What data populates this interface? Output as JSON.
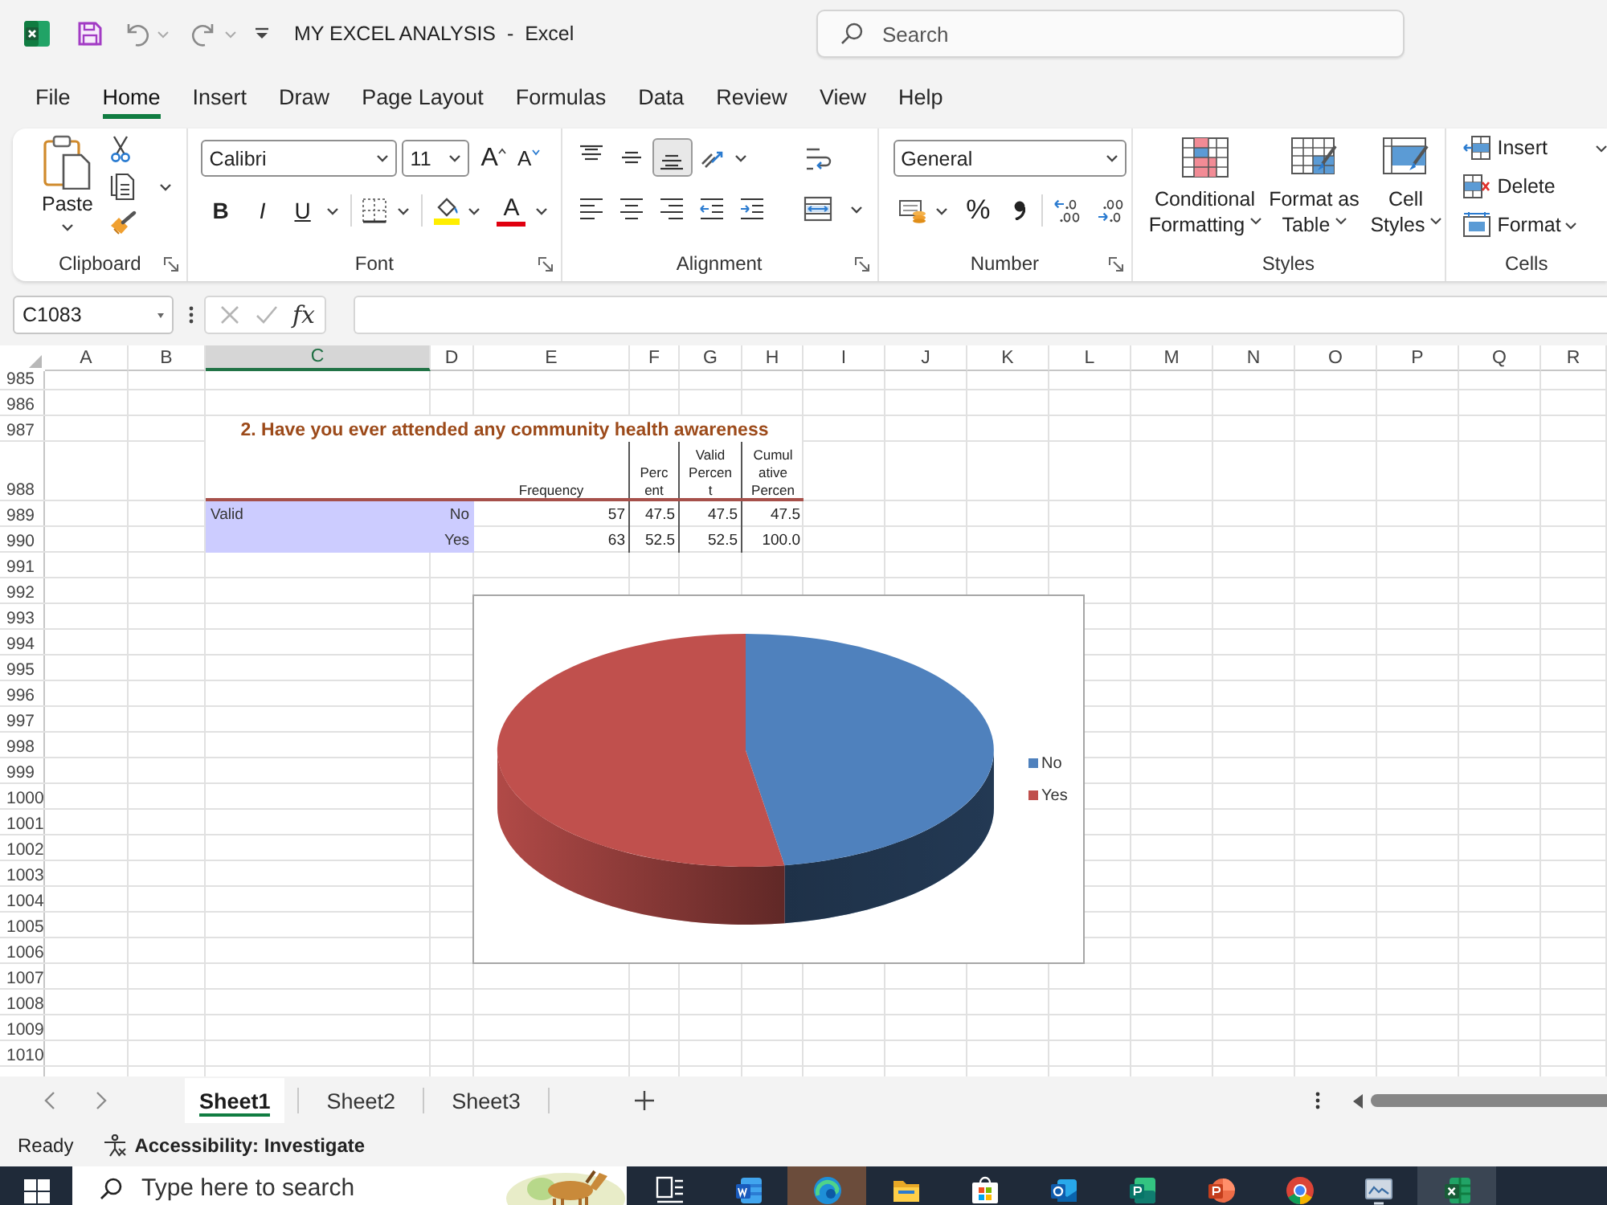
{
  "title_bar": {
    "title": "MY EXCEL ANALYSIS  -  Excel",
    "search": {
      "placeholder": "Search"
    }
  },
  "menu_tabs": [
    {
      "label": "File",
      "selected": false
    },
    {
      "label": "Home",
      "selected": true
    },
    {
      "label": "Insert",
      "selected": false
    },
    {
      "label": "Draw",
      "selected": false
    },
    {
      "label": "Page Layout",
      "selected": false
    },
    {
      "label": "Formulas",
      "selected": false
    },
    {
      "label": "Data",
      "selected": false
    },
    {
      "label": "Review",
      "selected": false
    },
    {
      "label": "View",
      "selected": false
    },
    {
      "label": "Help",
      "selected": false
    }
  ],
  "ribbon": {
    "groups": [
      {
        "kind": "clipboard",
        "label": "Clipboard",
        "paste": "Paste"
      },
      {
        "kind": "font",
        "label": "Font",
        "font_name": "Calibri",
        "font_size": "11",
        "grow": "A",
        "shrink": "A",
        "bold": "B",
        "italic": "I",
        "underline": "U",
        "font_color": "A"
      },
      {
        "kind": "alignment",
        "label": "Alignment",
        "vertical_align": [
          {
            "selected": false
          },
          {
            "selected": false
          },
          {
            "selected": true
          }
        ]
      },
      {
        "kind": "number",
        "label": "Number",
        "format": "General",
        "percent": "%"
      },
      {
        "kind": "styles",
        "label": "Styles",
        "buttons": [
          {
            "kind": "conditional",
            "lines": [
              "Conditional",
              "Formatting"
            ]
          },
          {
            "kind": "table",
            "lines": [
              "Format as",
              "Table"
            ]
          },
          {
            "kind": "cell",
            "lines": [
              "Cell",
              "Styles"
            ]
          }
        ]
      },
      {
        "kind": "cells",
        "label": "Cells",
        "buttons": [
          {
            "kind": "insert",
            "label": "Insert"
          },
          {
            "kind": "delete",
            "label": "Delete"
          },
          {
            "kind": "format",
            "label": "Format"
          }
        ]
      }
    ]
  },
  "formula_bar": {
    "name_box": "C1083",
    "function_label": "fx"
  },
  "sheet": {
    "columns": [
      {
        "label": "A",
        "selected": false
      },
      {
        "label": "B",
        "selected": false
      },
      {
        "label": "C",
        "selected": true
      },
      {
        "label": "D",
        "selected": false
      },
      {
        "label": "E",
        "selected": false
      },
      {
        "label": "F",
        "selected": false
      },
      {
        "label": "G",
        "selected": false
      },
      {
        "label": "H",
        "selected": false
      },
      {
        "label": "I",
        "selected": false
      },
      {
        "label": "J",
        "selected": false
      },
      {
        "label": "K",
        "selected": false
      },
      {
        "label": "L",
        "selected": false
      },
      {
        "label": "M",
        "selected": false
      },
      {
        "label": "N",
        "selected": false
      },
      {
        "label": "O",
        "selected": false
      },
      {
        "label": "P",
        "selected": false
      },
      {
        "label": "Q",
        "selected": false
      },
      {
        "label": "R",
        "selected": false
      }
    ],
    "row_numbers": [
      "985",
      "986",
      "987",
      "988",
      "989",
      "990",
      "991",
      "992",
      "993",
      "994",
      "995",
      "996",
      "997",
      "998",
      "999",
      "1000",
      "1001",
      "1002",
      "1003",
      "1004",
      "1005",
      "1006",
      "1007",
      "1008",
      "1009",
      "1010"
    ],
    "table": {
      "title": "2. Have you ever attended any community health awareness",
      "headers": [
        {
          "lines": [
            "Frequency"
          ]
        },
        {
          "lines": [
            "Perc",
            "ent"
          ]
        },
        {
          "lines": [
            "Valid",
            "Percen",
            "t"
          ]
        },
        {
          "lines": [
            "Cumul",
            "ative",
            "Percen"
          ]
        }
      ],
      "rows": [
        {
          "label": "Valid",
          "category": "No",
          "values": [
            "57",
            "47.5",
            "47.5",
            "47.5"
          ]
        },
        {
          "category": "Yes",
          "values": [
            "63",
            "52.5",
            "52.5",
            "100.0"
          ]
        }
      ]
    },
    "chart": {
      "legend": [
        {
          "label": "No",
          "color": "#4f81bd"
        },
        {
          "label": "Yes",
          "color": "#c0504d"
        }
      ]
    }
  },
  "sheet_tabs": {
    "tabs": [
      {
        "label": "Sheet1",
        "selected": true
      },
      {
        "label": "Sheet2",
        "selected": false
      },
      {
        "label": "Sheet3",
        "selected": false
      }
    ]
  },
  "status_bar": {
    "status": "Ready",
    "accessibility": "Accessibility: Investigate"
  },
  "taskbar": {
    "search": {
      "placeholder": "Type here to search"
    },
    "apps": [
      {
        "kind": "task_view",
        "active": false,
        "hovered": false
      },
      {
        "kind": "document",
        "active": false,
        "hovered": false
      },
      {
        "kind": "browser",
        "active": false,
        "hovered": true
      },
      {
        "kind": "folder",
        "active": false,
        "hovered": false
      },
      {
        "kind": "store",
        "active": false,
        "hovered": false
      },
      {
        "kind": "mail",
        "active": false,
        "hovered": false
      },
      {
        "kind": "publisher",
        "active": false,
        "hovered": false
      },
      {
        "kind": "presentation",
        "active": false,
        "hovered": false
      },
      {
        "kind": "web",
        "active": false,
        "hovered": false
      },
      {
        "kind": "monitor",
        "active": false,
        "hovered": false
      },
      {
        "kind": "spreadsheet",
        "active": true,
        "hovered": false
      }
    ]
  }
}
